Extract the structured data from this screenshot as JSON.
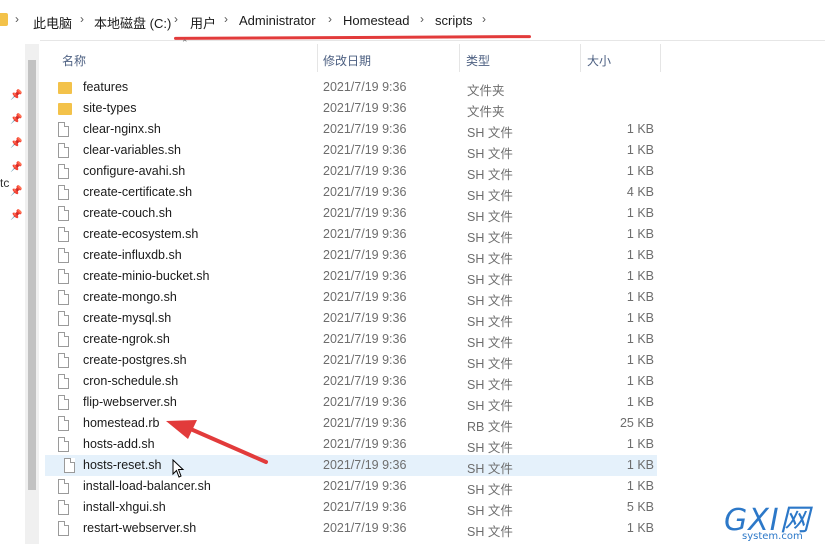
{
  "breadcrumb": [
    "此电脑",
    "本地磁盘 (C:)",
    "用户",
    "Administrator",
    "Homestead",
    "scripts"
  ],
  "left_pane": {
    "cut_text": "tc"
  },
  "columns": {
    "name": "名称",
    "date": "修改日期",
    "type": "类型",
    "size": "大小"
  },
  "files": [
    {
      "name": "features",
      "date": "2021/7/19 9:36",
      "type": "文件夹",
      "size": "",
      "kind": "folder"
    },
    {
      "name": "site-types",
      "date": "2021/7/19 9:36",
      "type": "文件夹",
      "size": "",
      "kind": "folder"
    },
    {
      "name": "clear-nginx.sh",
      "date": "2021/7/19 9:36",
      "type": "SH 文件",
      "size": "1 KB",
      "kind": "file"
    },
    {
      "name": "clear-variables.sh",
      "date": "2021/7/19 9:36",
      "type": "SH 文件",
      "size": "1 KB",
      "kind": "file"
    },
    {
      "name": "configure-avahi.sh",
      "date": "2021/7/19 9:36",
      "type": "SH 文件",
      "size": "1 KB",
      "kind": "file"
    },
    {
      "name": "create-certificate.sh",
      "date": "2021/7/19 9:36",
      "type": "SH 文件",
      "size": "4 KB",
      "kind": "file"
    },
    {
      "name": "create-couch.sh",
      "date": "2021/7/19 9:36",
      "type": "SH 文件",
      "size": "1 KB",
      "kind": "file"
    },
    {
      "name": "create-ecosystem.sh",
      "date": "2021/7/19 9:36",
      "type": "SH 文件",
      "size": "1 KB",
      "kind": "file"
    },
    {
      "name": "create-influxdb.sh",
      "date": "2021/7/19 9:36",
      "type": "SH 文件",
      "size": "1 KB",
      "kind": "file"
    },
    {
      "name": "create-minio-bucket.sh",
      "date": "2021/7/19 9:36",
      "type": "SH 文件",
      "size": "1 KB",
      "kind": "file"
    },
    {
      "name": "create-mongo.sh",
      "date": "2021/7/19 9:36",
      "type": "SH 文件",
      "size": "1 KB",
      "kind": "file"
    },
    {
      "name": "create-mysql.sh",
      "date": "2021/7/19 9:36",
      "type": "SH 文件",
      "size": "1 KB",
      "kind": "file"
    },
    {
      "name": "create-ngrok.sh",
      "date": "2021/7/19 9:36",
      "type": "SH 文件",
      "size": "1 KB",
      "kind": "file"
    },
    {
      "name": "create-postgres.sh",
      "date": "2021/7/19 9:36",
      "type": "SH 文件",
      "size": "1 KB",
      "kind": "file"
    },
    {
      "name": "cron-schedule.sh",
      "date": "2021/7/19 9:36",
      "type": "SH 文件",
      "size": "1 KB",
      "kind": "file"
    },
    {
      "name": "flip-webserver.sh",
      "date": "2021/7/19 9:36",
      "type": "SH 文件",
      "size": "1 KB",
      "kind": "file"
    },
    {
      "name": "homestead.rb",
      "date": "2021/7/19 9:36",
      "type": "RB 文件",
      "size": "25 KB",
      "kind": "file"
    },
    {
      "name": "hosts-add.sh",
      "date": "2021/7/19 9:36",
      "type": "SH 文件",
      "size": "1 KB",
      "kind": "file"
    },
    {
      "name": "hosts-reset.sh",
      "date": "2021/7/19 9:36",
      "type": "SH 文件",
      "size": "1 KB",
      "kind": "file",
      "selected": true
    },
    {
      "name": "install-load-balancer.sh",
      "date": "2021/7/19 9:36",
      "type": "SH 文件",
      "size": "1 KB",
      "kind": "file"
    },
    {
      "name": "install-xhgui.sh",
      "date": "2021/7/19 9:36",
      "type": "SH 文件",
      "size": "5 KB",
      "kind": "file"
    },
    {
      "name": "restart-webserver.sh",
      "date": "2021/7/19 9:36",
      "type": "SH 文件",
      "size": "1 KB",
      "kind": "file"
    }
  ],
  "watermark": {
    "logo": "GXI网",
    "sub": "system.com"
  },
  "colors": {
    "folder": "#f3c24a",
    "selection": "#e5f1fb",
    "annotation": "#e23b3b",
    "header_text": "#4d6082"
  }
}
